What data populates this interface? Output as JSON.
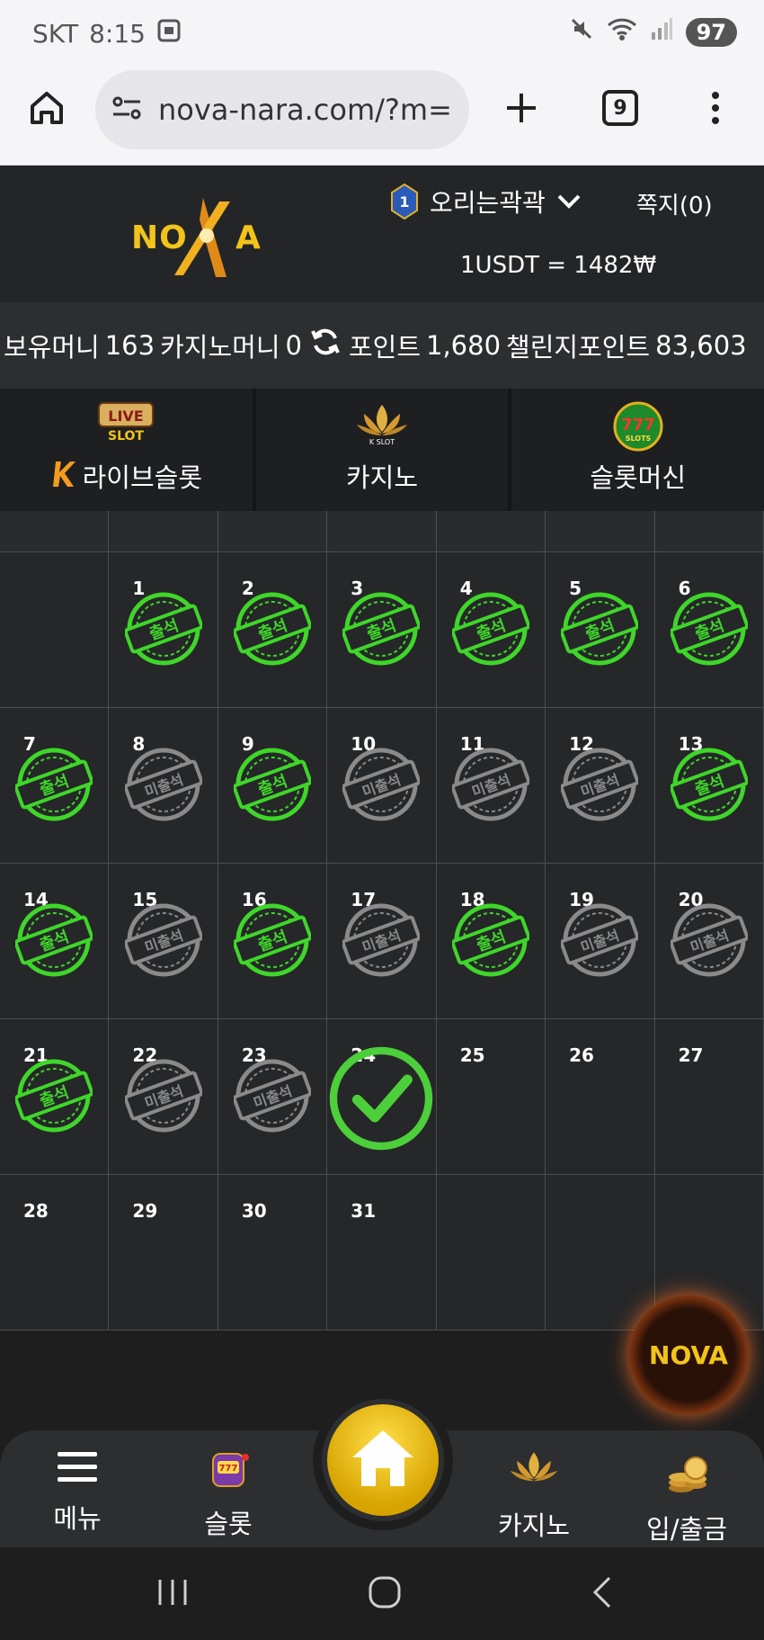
{
  "status_bar": {
    "carrier": "SKT",
    "time": "8:15",
    "battery": "97"
  },
  "browser": {
    "url": "nova-nara.com/?m=",
    "tab_count": "9"
  },
  "header": {
    "logo_text": "NOVA",
    "level": "1",
    "username": "오리는곽곽",
    "messages": "쪽지(0)",
    "exchange_rate": "1USDT = 1482₩"
  },
  "balances": {
    "holding_label": "보유머니",
    "holding_value": "163",
    "casino_label": "카지노머니",
    "casino_value": "0",
    "point_label": "포인트",
    "point_value": "1,680",
    "challenge_label": "챌린지포인트",
    "challenge_value": "83,603"
  },
  "game_tabs": [
    {
      "label": "라이브슬롯",
      "icon": "live-slot-icon",
      "badge": "LIVE",
      "sub": "SLOT"
    },
    {
      "label": "카지노",
      "icon": "kslot-lotus-icon",
      "sub": "K SLOT"
    },
    {
      "label": "슬롯머신",
      "icon": "777-slots-icon",
      "sub": "SLOTS"
    }
  ],
  "attendance": {
    "attended_label": "출석",
    "absent_label": "미출석",
    "days": [
      {
        "day": "",
        "status": "empty"
      },
      {
        "day": "1",
        "status": "attended"
      },
      {
        "day": "2",
        "status": "attended"
      },
      {
        "day": "3",
        "status": "attended"
      },
      {
        "day": "4",
        "status": "attended"
      },
      {
        "day": "5",
        "status": "attended"
      },
      {
        "day": "6",
        "status": "attended"
      },
      {
        "day": "7",
        "status": "attended"
      },
      {
        "day": "8",
        "status": "absent"
      },
      {
        "day": "9",
        "status": "attended"
      },
      {
        "day": "10",
        "status": "absent"
      },
      {
        "day": "11",
        "status": "absent"
      },
      {
        "day": "12",
        "status": "absent"
      },
      {
        "day": "13",
        "status": "attended"
      },
      {
        "day": "14",
        "status": "attended"
      },
      {
        "day": "15",
        "status": "absent"
      },
      {
        "day": "16",
        "status": "attended"
      },
      {
        "day": "17",
        "status": "absent"
      },
      {
        "day": "18",
        "status": "attended"
      },
      {
        "day": "19",
        "status": "absent"
      },
      {
        "day": "20",
        "status": "absent"
      },
      {
        "day": "21",
        "status": "attended"
      },
      {
        "day": "22",
        "status": "absent"
      },
      {
        "day": "23",
        "status": "absent"
      },
      {
        "day": "24",
        "status": "today"
      },
      {
        "day": "25",
        "status": "none"
      },
      {
        "day": "26",
        "status": "none"
      },
      {
        "day": "27",
        "status": "none"
      },
      {
        "day": "28",
        "status": "none"
      },
      {
        "day": "29",
        "status": "none"
      },
      {
        "day": "30",
        "status": "none"
      },
      {
        "day": "31",
        "status": "none"
      },
      {
        "day": "",
        "status": "empty"
      },
      {
        "day": "",
        "status": "empty"
      },
      {
        "day": "",
        "status": "empty"
      }
    ]
  },
  "colors": {
    "attended": "#3fd62a",
    "absent": "#8a8a8a",
    "today": "#4ccf3a",
    "gold": "#f2c41a"
  },
  "bottom_nav": {
    "menu": "메뉴",
    "slot": "슬롯",
    "casino": "카지노",
    "deposit": "입/출금"
  },
  "float_logo": "NOVA"
}
